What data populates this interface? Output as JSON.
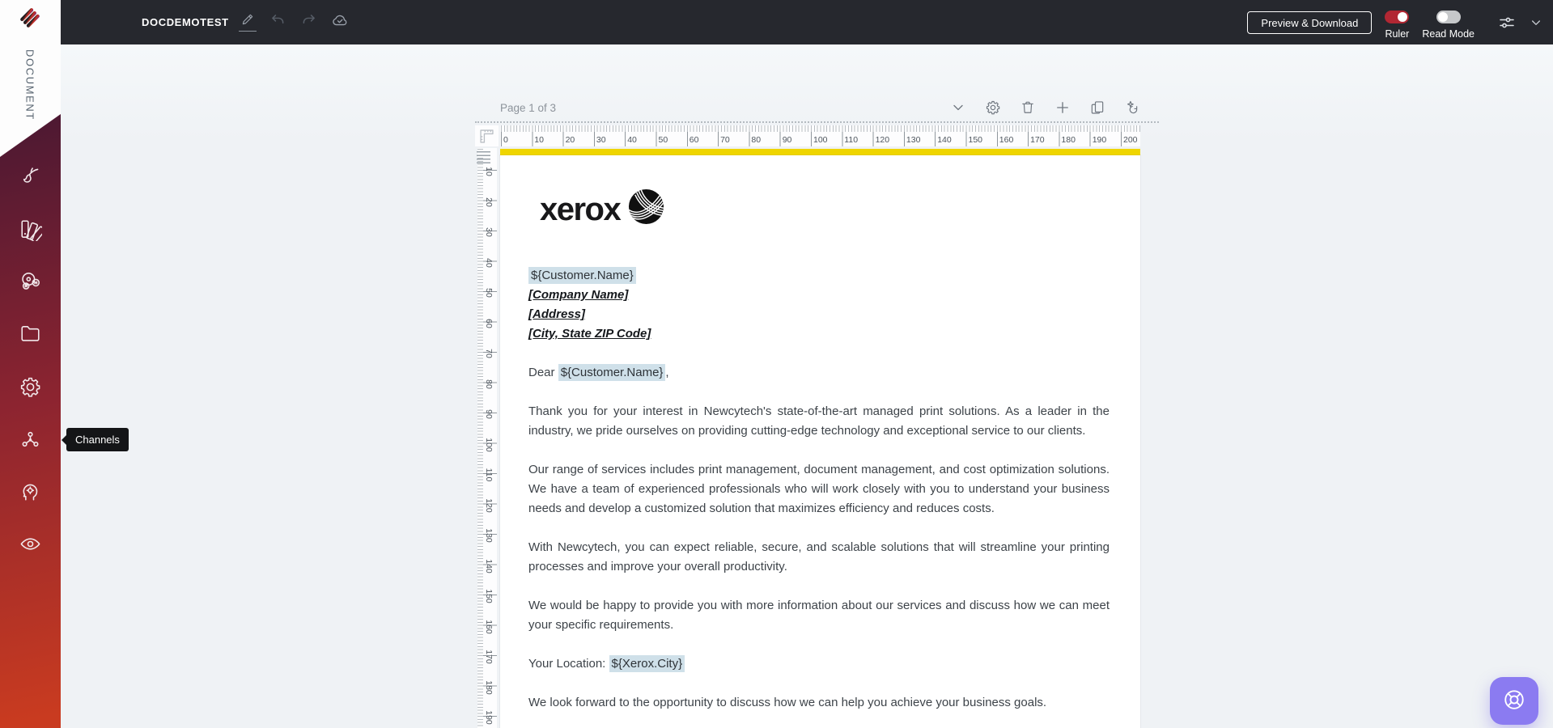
{
  "topbar": {
    "title": "DOCDEMOTEST",
    "preview_download_button": "Preview & Download",
    "ruler_toggle": {
      "label": "Ruler",
      "on": true
    },
    "read_mode_toggle": {
      "label": "Read Mode",
      "on": false
    }
  },
  "sidebar": {
    "section_label": "DOCUMENT",
    "tooltip_label": "Channels"
  },
  "canvas": {
    "page_indicator": "Page 1 of 3",
    "h_ruler_labels": [
      "0",
      "10",
      "20",
      "30",
      "40",
      "50",
      "60",
      "70",
      "80",
      "90",
      "100",
      "110",
      "120",
      "130",
      "140",
      "150",
      "160",
      "170",
      "180",
      "190",
      "200"
    ],
    "v_ruler_labels": [
      "10",
      "20",
      "30",
      "40",
      "50",
      "60",
      "70",
      "80",
      "90",
      "100",
      "110",
      "120",
      "130",
      "140",
      "150",
      "160",
      "170",
      "180",
      "190"
    ]
  },
  "document": {
    "logo_text": "xerox",
    "recipient_variable": "${Customer.Name}",
    "recipient_lines": [
      "[Company Name]",
      "[Address]",
      "[City, State ZIP Code]"
    ],
    "salutation": {
      "prefix": "Dear ",
      "variable": "${Customer.Name}",
      "suffix": ","
    },
    "paragraphs": [
      "Thank you for your interest in Newcytech's state-of-the-art managed print solutions. As a leader in the industry, we pride ourselves on providing cutting-edge technology and exceptional service to our clients.",
      "Our range of services includes print management, document management, and cost optimization solutions. We have a team of experienced professionals who will work closely with you to understand your business needs and develop a customized solution that maximizes efficiency and reduces costs.",
      "With Newcytech, you can expect reliable, secure, and scalable solutions that will streamline your printing processes and improve your overall productivity.",
      "We would be happy to provide you with more information about our services and discuss how we can meet your specific requirements."
    ],
    "location": {
      "label": "Your Location: ",
      "variable": "${Xerox.City}"
    },
    "clipped_line": "We look forward to the opportunity to discuss how we can help you achieve your business goals."
  },
  "colors": {
    "topbar_bg": "#26282e",
    "toggle_on_red": "#b12733",
    "sidebar_gradient_top": "#451733",
    "sidebar_gradient_bottom": "#c93b20",
    "page_strip_yellow": "#efd500",
    "variable_highlight": "#cfe0e9",
    "help_button_purple": "#8b7bf1"
  }
}
